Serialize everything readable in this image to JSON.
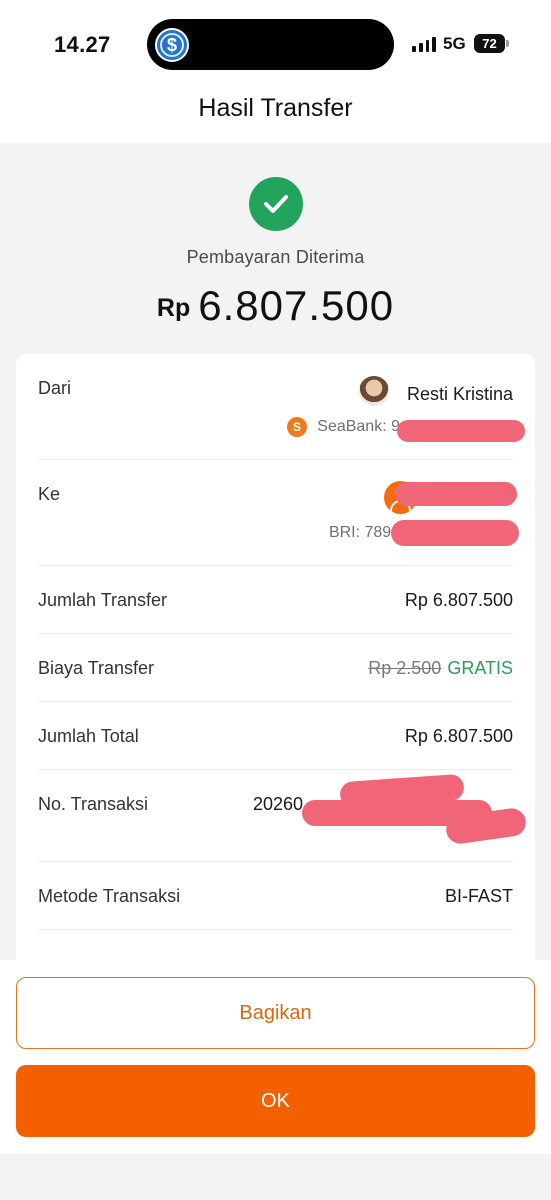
{
  "status_bar": {
    "time": "14.27",
    "network": "5G",
    "battery": "72"
  },
  "header": {
    "title": "Hasil Transfer"
  },
  "result": {
    "status": "Pembayaran Diterima",
    "currency": "Rp",
    "amount": "6.807.500",
    "success_color": "#22a45d"
  },
  "details": {
    "from": {
      "label": "Dari",
      "name": "Resti Kristina",
      "bank_line": "SeaBank: 9"
    },
    "to": {
      "label": "Ke",
      "bank_line": "BRI: 78910"
    },
    "transfer_amount": {
      "label": "Jumlah Transfer",
      "value": "Rp 6.807.500"
    },
    "transfer_fee": {
      "label": "Biaya Transfer",
      "original": "Rp 2.500",
      "value": "GRATIS"
    },
    "total": {
      "label": "Jumlah Total",
      "value": "Rp 6.807.500"
    },
    "transaction_no": {
      "label": "No. Transaksi",
      "value": "20260"
    },
    "method": {
      "label": "Metode Transaksi",
      "value": "BI-FAST"
    }
  },
  "actions": {
    "share_label": "Bagikan",
    "ok_label": "OK",
    "accent_color": "#f45f00"
  }
}
